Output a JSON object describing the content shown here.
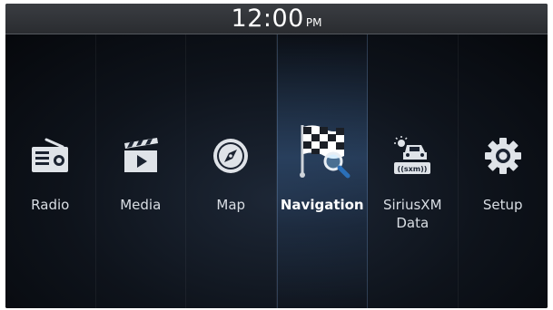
{
  "status": {
    "time": "12:00",
    "ampm": "PM"
  },
  "menu": [
    {
      "label": "Radio",
      "icon": "radio-icon"
    },
    {
      "label": "Media",
      "icon": "media-icon"
    },
    {
      "label": "Map",
      "icon": "compass-icon"
    },
    {
      "label": "Navigation",
      "icon": "checkered-flag-icon",
      "selected": true
    },
    {
      "label_line1": "SiriusXM",
      "label_line2": "Data",
      "icon": "sxm-car-icon",
      "badge": "((sxm))"
    },
    {
      "label": "Setup",
      "icon": "gear-icon"
    }
  ],
  "colors": {
    "active_glow": "#3c6496",
    "text": "#d9dee4"
  }
}
